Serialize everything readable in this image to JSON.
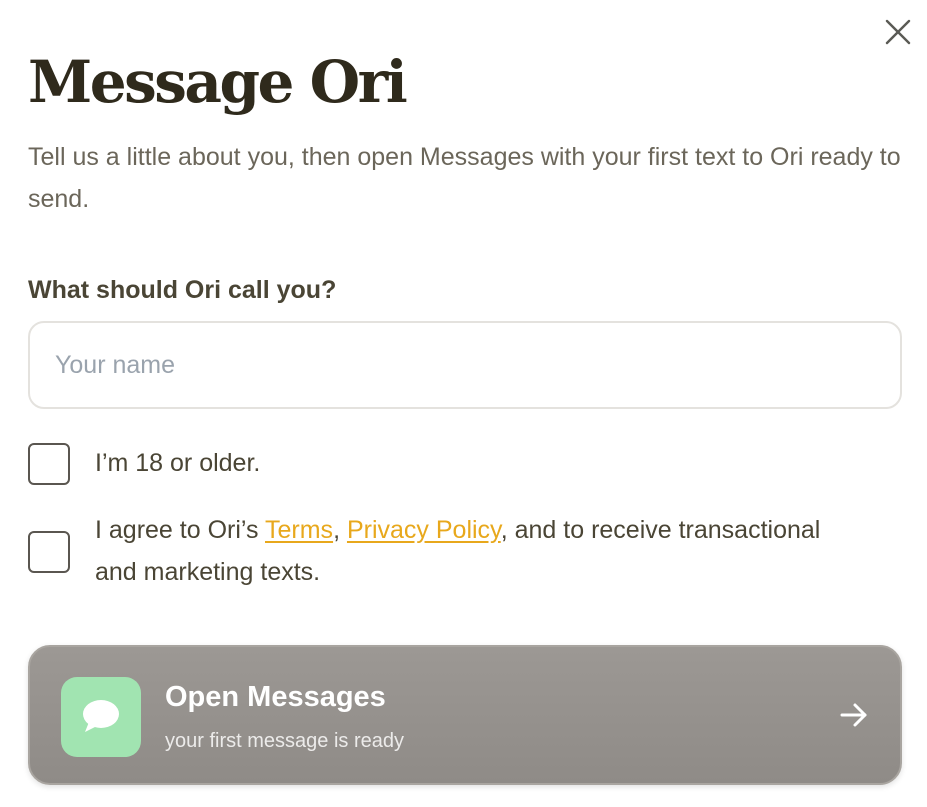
{
  "dialog": {
    "title": "Message Ori",
    "subtitle": "Tell us a little about you, then open Messages with your first text to Ori ready to send.",
    "close_icon": "close-icon"
  },
  "name_field": {
    "label": "What should Ori call you?",
    "placeholder": "Your name",
    "value": ""
  },
  "age_checkbox": {
    "checked": false,
    "label": "I’m 18 or older."
  },
  "consent_checkbox": {
    "checked": false,
    "prefix": "I agree to Ori’s ",
    "terms_link": "Terms",
    "separator": ", ",
    "privacy_link": "Privacy Policy",
    "suffix": ", and to receive transactional and marketing texts."
  },
  "cta": {
    "title": "Open Messages",
    "subtitle": "your first message is ready",
    "app_icon": "messages-chat-bubble-icon",
    "arrow_icon": "arrow-right-icon"
  },
  "colors": {
    "title": "#2f2a1c",
    "body_text": "#6b665a",
    "link": "#e8a81c",
    "cta_background": "#938f8b",
    "app_tile": "#a1e4b1"
  }
}
